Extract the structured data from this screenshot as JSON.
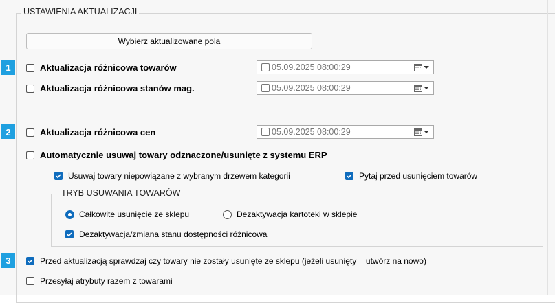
{
  "settings": {
    "group_title": "USTAWIENIA AKTUALIZACJI",
    "select_fields_button": "Wybierz aktualizowane pola",
    "badges": [
      "1",
      "2",
      "3"
    ],
    "rows": {
      "diff_products": {
        "label": "Aktualizacja różnicowa towarów",
        "checked": false,
        "date_checked": false,
        "date": "05.09.2025 08:00:29"
      },
      "diff_stock": {
        "label": "Aktualizacja różnicowa stanów mag.",
        "checked": false,
        "date_checked": false,
        "date": "05.09.2025 08:00:29"
      },
      "diff_prices": {
        "label": "Aktualizacja różnicowa cen",
        "checked": false,
        "date_checked": false,
        "date": "05.09.2025 08:00:29"
      },
      "auto_remove": {
        "label": "Automatycznie usuwaj towary odznaczone/usunięte z systemu ERP",
        "checked": false
      },
      "remove_unrelated": {
        "label": "Usuwaj towary niepowiązane z wybranym drzewem kategorii",
        "checked": true
      },
      "ask_before_remove": {
        "label": "Pytaj przed usunięciem towarów",
        "checked": true
      }
    },
    "removal_mode": {
      "title": "TRYB USUWANIA TOWARÓW",
      "option_full": "Całkowite usunięcie ze sklepu",
      "option_deactivate": "Dezaktywacja kartoteki w sklepie",
      "selected": "Całkowite usunięcie ze sklepu",
      "diff_deactivation": {
        "label": "Dezaktywacja/zmiana stanu dostępności różnicowa",
        "checked": true
      }
    },
    "check_removed": {
      "label": "Przed aktualizacją sprawdzaj czy towary nie zostały usunięte ze sklepu (jeżeli usunięty = utwórz na nowo)",
      "checked": true
    },
    "send_attributes": {
      "label": "Przesyłaj atrybuty razem z towarami",
      "checked": false
    }
  },
  "colors": {
    "accent": "#0f6cbd",
    "badge": "#1fa0e0"
  },
  "icons": {
    "checkmark": "checkmark-icon",
    "calendar": "calendar-icon",
    "dropdown": "chevron-down-icon"
  }
}
